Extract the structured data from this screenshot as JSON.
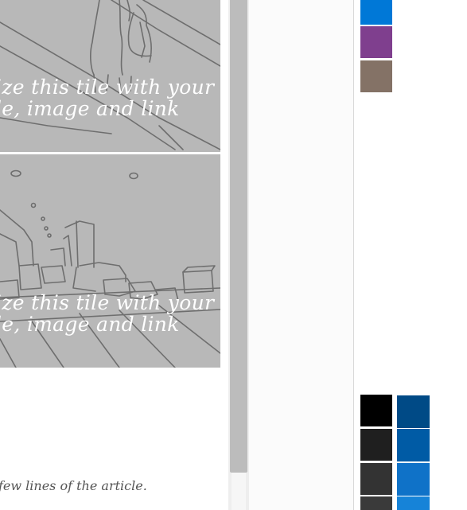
{
  "tiles": [
    {
      "caption_line1": "ize this tile with your",
      "caption_line2": "le, image and link"
    },
    {
      "caption_line1": "ize this tile with your",
      "caption_line2": "le, image and link"
    }
  ],
  "article_snippet": "few lines of the article.",
  "swatches_top": [
    {
      "name": "blue",
      "color": "#0078d7"
    },
    {
      "name": "purple",
      "color": "#7f3f8e"
    },
    {
      "name": "taupe",
      "color": "#847266"
    }
  ],
  "swatches_bottom_left": [
    {
      "name": "black",
      "color": "#000000"
    },
    {
      "name": "dark-gray",
      "color": "#1f1f1f"
    },
    {
      "name": "charcoal",
      "color": "#333333"
    },
    {
      "name": "graphite",
      "color": "#3a3a3a"
    }
  ],
  "swatches_bottom_right": [
    {
      "name": "navy",
      "color": "#004a86"
    },
    {
      "name": "dark-blue",
      "color": "#005ba5"
    },
    {
      "name": "medium-blue",
      "color": "#0f72c8"
    },
    {
      "name": "bright-blue",
      "color": "#1683d8"
    }
  ]
}
